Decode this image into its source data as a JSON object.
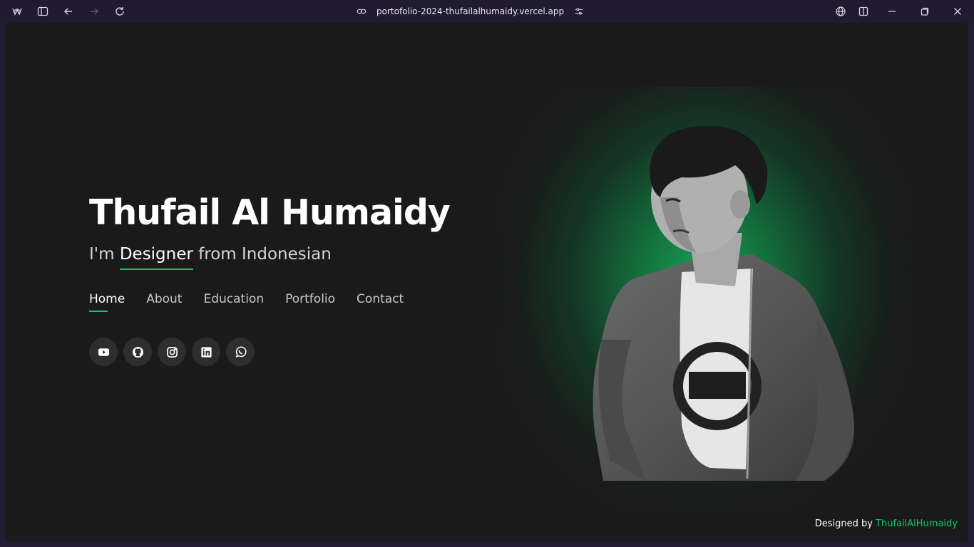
{
  "browser": {
    "url": "portofolio-2024-thufailalhumaidy.vercel.app",
    "icons": [
      "app-logo-icon",
      "sidebar-toggle-icon",
      "back-arrow-icon",
      "forward-arrow-icon",
      "reload-icon",
      "link-icon",
      "site-settings-icon",
      "globe-icon",
      "split-view-icon",
      "minimize-icon",
      "restore-icon",
      "close-icon"
    ]
  },
  "hero": {
    "name": "Thufail Al Humaidy",
    "sub_prefix": "I'm",
    "sub_highlight": "Designer",
    "sub_suffix": "from Indonesian"
  },
  "nav": {
    "items": [
      {
        "label": "Home",
        "active": true
      },
      {
        "label": "About"
      },
      {
        "label": "Education"
      },
      {
        "label": "Portfolio"
      },
      {
        "label": "Contact"
      }
    ]
  },
  "socials": [
    "youtube-icon",
    "github-icon",
    "instagram-icon",
    "linkedin-icon",
    "whatsapp-icon"
  ],
  "footer": {
    "prefix": "Designed by",
    "author": "ThufailAlHumaidy"
  },
  "colors": {
    "accent": "#19c46a",
    "background": "#1a1a1a",
    "chrome": "#201b30"
  }
}
